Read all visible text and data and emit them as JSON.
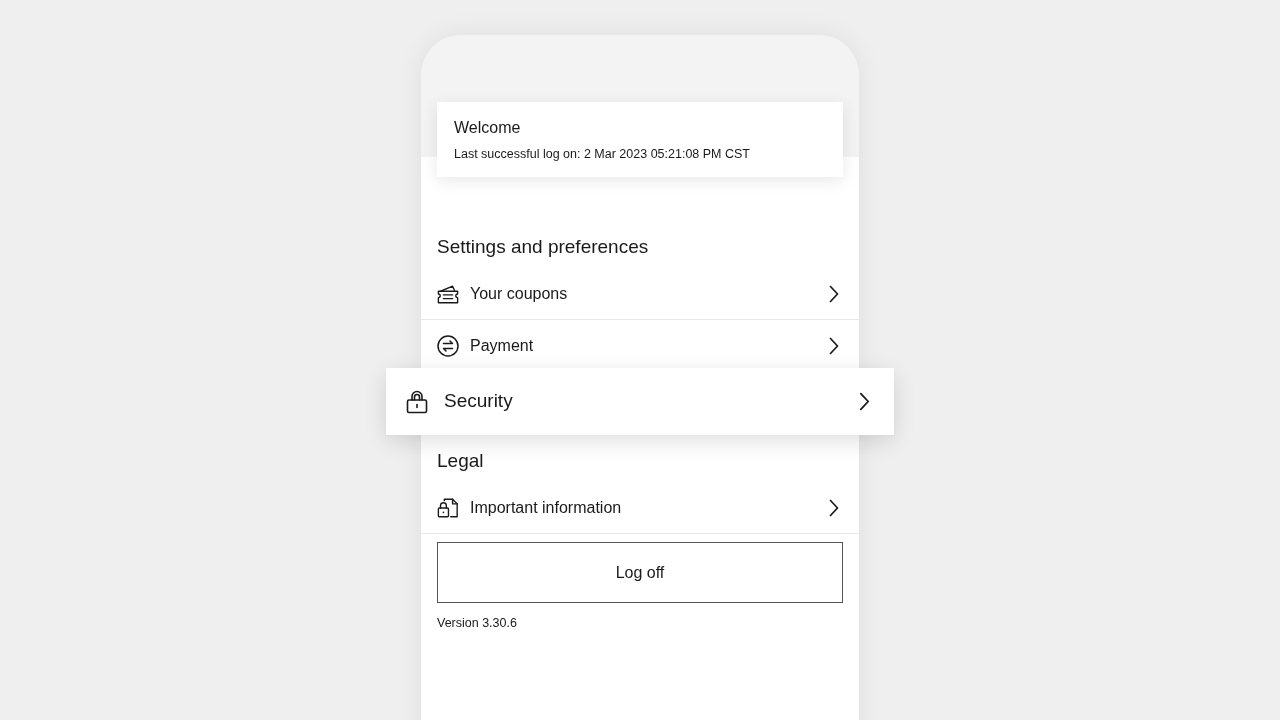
{
  "welcome_card": {
    "title": "Welcome",
    "last_logon": "Last successful log on: 2 Mar 2023 05:21:08 PM CST"
  },
  "sections": [
    {
      "title": "Settings and preferences",
      "items": [
        {
          "label": "Your coupons",
          "highlighted": false
        },
        {
          "label": "Payment",
          "highlighted": false
        },
        {
          "label": "Security",
          "highlighted": true
        }
      ]
    },
    {
      "title": "Legal",
      "items": [
        {
          "label": "Important information",
          "highlighted": false
        }
      ]
    }
  ],
  "logoff_button": {
    "label": "Log off"
  },
  "version": "Version 3.30.6"
}
